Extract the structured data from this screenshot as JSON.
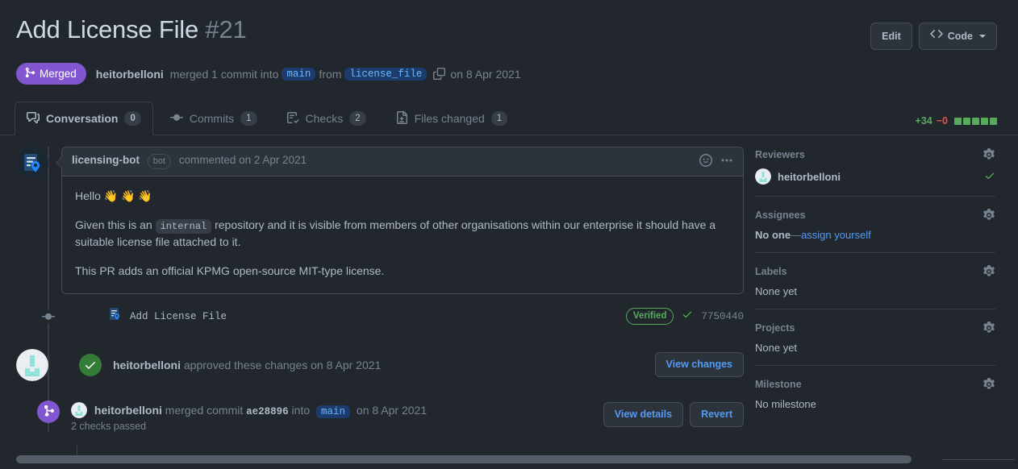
{
  "header": {
    "title": "Add License File",
    "number": "#21",
    "edit_label": "Edit",
    "code_label": "Code",
    "state": "Merged",
    "author": "heitorbelloni",
    "merged_text": "merged 1 commit into",
    "base_branch": "main",
    "from_text": "from",
    "head_branch": "license_file",
    "date": "on 8 Apr 2021"
  },
  "tabs": [
    {
      "label": "Conversation",
      "count": "0",
      "icon": "comment-icon",
      "active": true
    },
    {
      "label": "Commits",
      "count": "1",
      "icon": "commit-icon",
      "active": false
    },
    {
      "label": "Checks",
      "count": "2",
      "icon": "checklist-icon",
      "active": false
    },
    {
      "label": "Files changed",
      "count": "1",
      "icon": "file-diff-icon",
      "active": false
    }
  ],
  "diffstat": {
    "additions": "+34",
    "deletions": "−0",
    "blocks": 5
  },
  "comment": {
    "author": "licensing-bot",
    "bot_tag": "bot",
    "commented_text": "commented on 2 Apr 2021",
    "greeting": "Hello 👋 👋 👋",
    "para2_before": "Given this is an",
    "para2_code": "internal",
    "para2_after": "repository and it is visible from members of other organisations within our enterprise it should have a suitable license file attached to it.",
    "para3": "This PR adds an official KPMG open-source MIT-type license."
  },
  "commit_row": {
    "message": "Add License File",
    "verified": "Verified",
    "sha": "7750440"
  },
  "approval": {
    "author": "heitorbelloni",
    "text": "approved these changes on 8 Apr 2021",
    "button": "View changes"
  },
  "merge_event": {
    "author": "heitorbelloni",
    "merged_commit_text": "merged commit",
    "sha": "ae28896",
    "into_text": "into",
    "branch": "main",
    "date": "on 8 Apr 2021",
    "checks": "2 checks passed",
    "view_details": "View details",
    "revert": "Revert"
  },
  "sidebar": {
    "reviewers": {
      "title": "Reviewers",
      "user": "heitorbelloni"
    },
    "assignees": {
      "title": "Assignees",
      "none": "No one",
      "dash": "—",
      "link": "assign yourself"
    },
    "labels": {
      "title": "Labels",
      "value": "None yet"
    },
    "projects": {
      "title": "Projects",
      "value": "None yet"
    },
    "milestone": {
      "title": "Milestone",
      "value": "No milestone"
    }
  },
  "colors": {
    "merged_purple": "#8256d0",
    "green": "#57ab5a",
    "blue": "#539bf5",
    "bg": "#22272e"
  }
}
